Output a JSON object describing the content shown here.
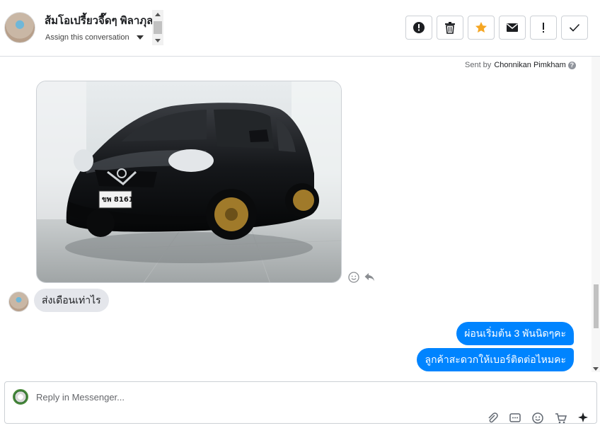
{
  "header": {
    "contact_name": "ส้มโอเปรี้ยวจี๊ดๆ พิลาภุล",
    "assign_label": "Assign this conversation",
    "toolbar": [
      {
        "name": "mark-spam",
        "icon": "exclamation-circle-icon"
      },
      {
        "name": "delete",
        "icon": "trash-icon"
      },
      {
        "name": "star",
        "icon": "star-icon",
        "color": "#f5a623"
      },
      {
        "name": "mark-unread",
        "icon": "envelope-icon"
      },
      {
        "name": "follow-up",
        "icon": "exclamation-icon"
      },
      {
        "name": "mark-done",
        "icon": "checkmark-icon"
      }
    ]
  },
  "conversation": {
    "sent_by_label": "Sent by",
    "sent_by_name": "Chonnikan Pimkham",
    "image_message": {
      "icon": "car-photo"
    },
    "incoming_message": "ส่งเดือนเท่าไร",
    "outgoing_messages": [
      "ผ่อนเริ่มต้น 3 พันนิดๆคะ",
      "ลูกค้าสะดวกให้เบอร์ติดต่อไหมคะ"
    ]
  },
  "reply": {
    "placeholder": "Reply in Messenger..."
  },
  "colors": {
    "accent": "#0084ff",
    "incoming_bubble": "#e4e6eb",
    "star": "#f5a623"
  }
}
